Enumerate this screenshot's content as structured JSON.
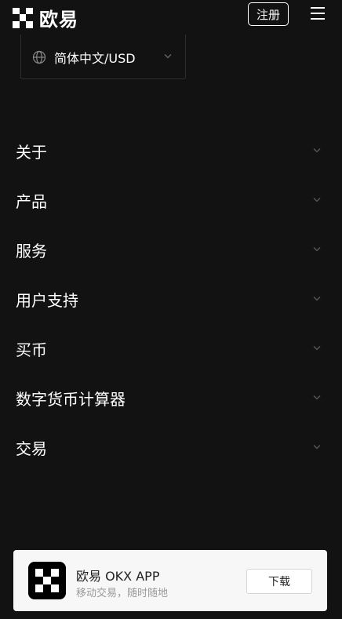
{
  "header": {
    "brand": "欧易",
    "register_label": "注册",
    "menu_icon": "hamburger-menu-icon"
  },
  "language": {
    "label": "简体中文/USD",
    "icon": "globe-icon"
  },
  "nav": {
    "items": [
      {
        "label": "关于"
      },
      {
        "label": "产品"
      },
      {
        "label": "服务"
      },
      {
        "label": "用户支持"
      },
      {
        "label": "买币"
      },
      {
        "label": "数字货币计算器"
      },
      {
        "label": "交易"
      }
    ]
  },
  "app_banner": {
    "title": "欧易 OKX APP",
    "subtitle": "移动交易，随时随地",
    "download_label": "下载"
  },
  "colors": {
    "background": "#121212",
    "text": "#ffffff",
    "chevron": "#5a5a5a",
    "banner_bg": "#f7f7f7"
  }
}
